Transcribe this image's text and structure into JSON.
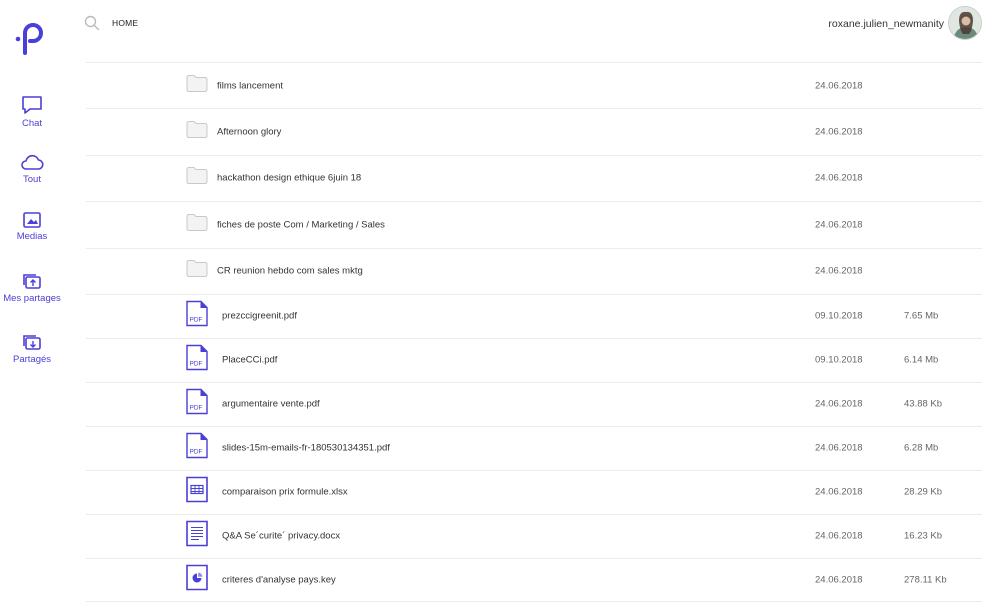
{
  "app": {
    "logo_glyph": ".p",
    "accent_color": "#4a3fd6"
  },
  "sidebar": {
    "items": [
      {
        "label": "Chat",
        "icon": "chat-bubble-icon"
      },
      {
        "label": "Tout",
        "icon": "cloud-icon"
      },
      {
        "label": "Medias",
        "icon": "image-icon"
      },
      {
        "label": "Mes partages",
        "icon": "share-upload-icon"
      },
      {
        "label": "Partagés",
        "icon": "share-download-icon"
      }
    ]
  },
  "topbar": {
    "breadcrumb": "HOME",
    "username": "roxane.julien_newmanity"
  },
  "files": [
    {
      "type": "folder",
      "name": "films lancement",
      "date": "24.06.2018",
      "size": ""
    },
    {
      "type": "folder",
      "name": "Afternoon glory",
      "date": "24.06.2018",
      "size": ""
    },
    {
      "type": "folder",
      "name": "hackathon design ethique 6juin 18",
      "date": "24.06.2018",
      "size": ""
    },
    {
      "type": "folder",
      "name": "fiches de poste Com / Marketing / Sales",
      "date": "24.06.2018",
      "size": ""
    },
    {
      "type": "folder",
      "name": "CR reunion hebdo com sales mktg",
      "date": "24.06.2018",
      "size": ""
    },
    {
      "type": "pdf",
      "name": "prezccigreenit.pdf",
      "date": "09.10.2018",
      "size": "7.65 Mb"
    },
    {
      "type": "pdf",
      "name": "PlaceCCi.pdf",
      "date": "09.10.2018",
      "size": "6.14 Mb"
    },
    {
      "type": "pdf",
      "name": "argumentaire vente.pdf",
      "date": "24.06.2018",
      "size": "43.88 Kb"
    },
    {
      "type": "pdf",
      "name": "slides-15m-emails-fr-180530134351.pdf",
      "date": "24.06.2018",
      "size": "6.28 Mb"
    },
    {
      "type": "xlsx",
      "name": "comparaison prix formule.xlsx",
      "date": "24.06.2018",
      "size": "28.29 Kb"
    },
    {
      "type": "docx",
      "name": "Q&A Se´curite´ privacy.docx",
      "date": "24.06.2018",
      "size": "16.23 Kb"
    },
    {
      "type": "key",
      "name": "criteres d'analyse pays.key",
      "date": "24.06.2018",
      "size": "278.11 Kb"
    }
  ],
  "labels": {
    "pdf_badge": "PDF"
  }
}
